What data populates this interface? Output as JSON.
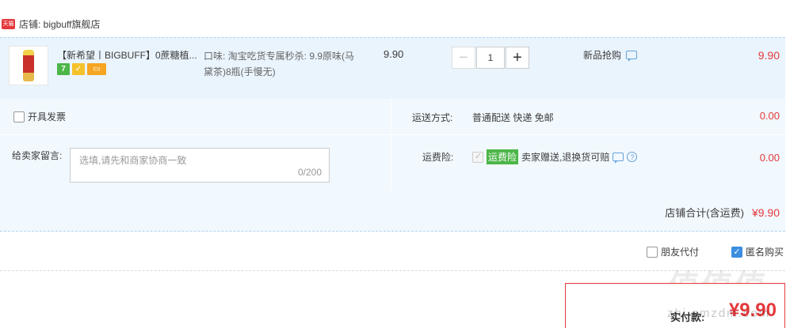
{
  "store": {
    "badge": "天猫",
    "label": "店铺: bigbuff旗舰店"
  },
  "item": {
    "title": "【新希望丨BIGBUFF】0蔗糖植...",
    "badges": [
      "7",
      "",
      ""
    ],
    "sku": "口味: 淘宝吃货专属秒杀: 9.9原味(马黛茶)8瓶(手慢无)",
    "unit_price": "9.90",
    "quantity": "1",
    "minus": "−",
    "plus": "+",
    "promo": "新品抢购",
    "total": "9.90"
  },
  "invoice": {
    "label": "开具发票"
  },
  "message": {
    "label": "给卖家留言:",
    "placeholder": "选填,请先和商家协商一致",
    "count": "0/200"
  },
  "shipping": {
    "label": "运送方式:",
    "value": "普通配送 快递 免邮",
    "price": "0.00"
  },
  "insurance": {
    "label": "运费险:",
    "tag": "运费险",
    "text": "卖家赠送,退换货可赔",
    "help": "?",
    "price": "0.00"
  },
  "store_total": {
    "label": "店铺合计(含运费)",
    "value": "¥9.90"
  },
  "options": {
    "friend_pay": "朋友代付",
    "anonymous": "匿名购买",
    "anonymous_checked": true
  },
  "payment": {
    "label": "实付款:",
    "value": "¥9.90"
  },
  "watermark": {
    "main": "值值值",
    "sub": "zhi.smzdm.com"
  },
  "colors": {
    "accent_red": "#e4393c",
    "row_blue": "#eaf4fd",
    "tag_green": "#4cb648",
    "check_blue": "#3c8ee0"
  }
}
